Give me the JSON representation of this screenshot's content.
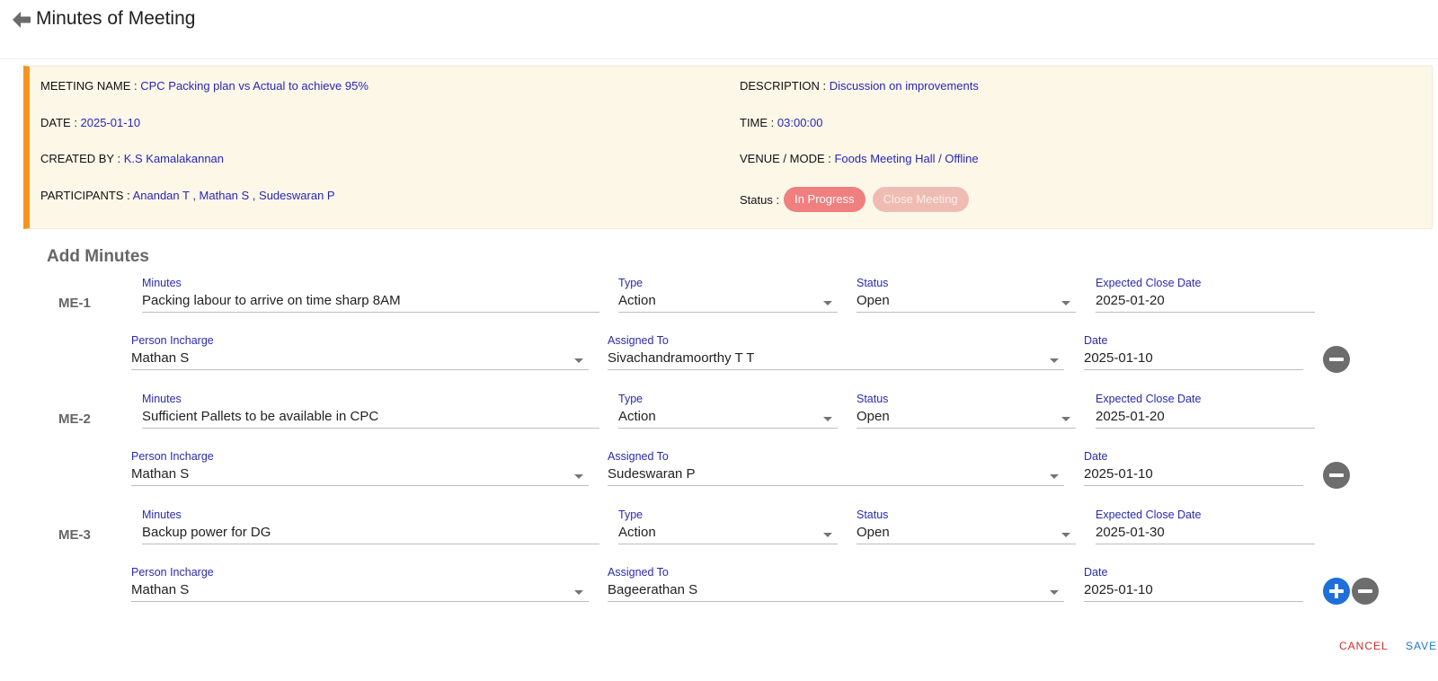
{
  "header": {
    "title": "Minutes of Meeting"
  },
  "meeting": {
    "name_label": "MEETING NAME : ",
    "name": "CPC Packing plan vs Actual to achieve 95%",
    "description_label": "DESCRIPTION : ",
    "description": "Discussion on improvements",
    "date_label": "DATE : ",
    "date": "2025-01-10",
    "time_label": "TIME : ",
    "time": "03:00:00",
    "created_by_label": "CREATED BY : ",
    "created_by": "K.S Kamalakannan",
    "venue_label": "VENUE / MODE : ",
    "venue": "Foods Meeting Hall / Offline",
    "participants_label": "PARTICIPANTS : ",
    "participants": "Anandan T , Mathan S , Sudeswaran P",
    "status_label": "Status :",
    "status": "In Progress",
    "close_button": "Close Meeting",
    "accent_color": "#f7941d"
  },
  "add_minutes": {
    "title": "Add Minutes",
    "labels": {
      "minutes": "Minutes",
      "type": "Type",
      "status": "Status",
      "expected_close_date": "Expected Close Date",
      "person_incharge": "Person Incharge",
      "assigned_to": "Assigned To",
      "date": "Date"
    },
    "items": [
      {
        "id": "ME-1",
        "minutes": "Packing labour to arrive on time sharp 8AM",
        "type": "Action",
        "status": "Open",
        "expected_close_date": "2025-01-20",
        "person_incharge": "Mathan S",
        "assigned_to": "Sivachandramoorthy T T",
        "date": "2025-01-10"
      },
      {
        "id": "ME-2",
        "minutes": "Sufficient Pallets to be available in CPC",
        "type": "Action",
        "status": "Open",
        "expected_close_date": "2025-01-20",
        "person_incharge": "Mathan S",
        "assigned_to": "Sudeswaran P",
        "date": "2025-01-10"
      },
      {
        "id": "ME-3",
        "minutes": "Backup power for DG",
        "type": "Action",
        "status": "Open",
        "expected_close_date": "2025-01-30",
        "person_incharge": "Mathan S",
        "assigned_to": "Bageerathan S",
        "date": "2025-01-10"
      }
    ]
  },
  "footer": {
    "cancel_label": "CANCEL",
    "save_label": "SAVE"
  }
}
